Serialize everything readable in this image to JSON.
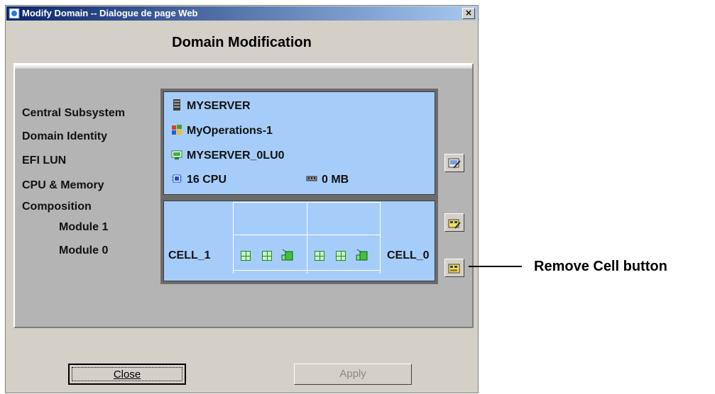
{
  "window": {
    "title": "Modify Domain -- Dialogue de page Web",
    "close_glyph": "×"
  },
  "heading": "Domain Modification",
  "labels": {
    "central_subsystem": "Central Subsystem",
    "domain_identity": "Domain Identity",
    "efi_lun": "EFI LUN",
    "cpu_memory": "CPU & Memory",
    "composition": "Composition",
    "module_1": "Module 1",
    "module_0": "Module 0"
  },
  "identity": {
    "server": "MYSERVER",
    "domain": "MyOperations-1",
    "lun": "MYSERVER_0LU0",
    "cpu": "16 CPU",
    "memory": "0 MB"
  },
  "composition": {
    "cell_left": "CELL_1",
    "cell_right": "CELL_0"
  },
  "buttons": {
    "close": "Close",
    "apply": "Apply"
  },
  "callout": "Remove Cell button",
  "colors": {
    "dialog_bg": "#d4d0c8",
    "panel_bg": "#a6cdfa",
    "titlebar_start": "#0a246a",
    "titlebar_end": "#a6caf0"
  }
}
